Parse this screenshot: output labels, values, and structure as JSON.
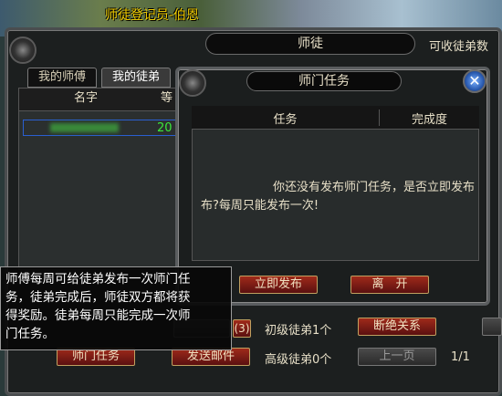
{
  "npc_title": "师徒登记员-伯恩",
  "main": {
    "title": "师徒",
    "cap_label": "可收徒弟数",
    "tabs": [
      {
        "label": "我的师傅"
      },
      {
        "label": "我的徒弟"
      }
    ],
    "list_header_name": "名字",
    "list_header_level": "等",
    "selected_row_level": "20"
  },
  "task_dialog": {
    "title": "师门任务",
    "col_task": "任务",
    "col_progress": "完成度",
    "message_line1": "你还没有发布师门任务，是否立即发布",
    "message_line2": "布?每周只能发布一次!",
    "publish_label": "立即发布",
    "leave_label": "离　开"
  },
  "tooltip": {
    "lines": [
      "师傅每周可给徒弟发布一次师门任",
      "务，徒弟完成后，师徒双方都将获",
      "得奖励。徒弟每周只能完成一次师",
      "门任务。"
    ]
  },
  "bottom": {
    "badge_count": "(3)",
    "junior_label": "初级徒弟1个",
    "break_label": "断绝关系",
    "senior_label": "高级徒弟0个",
    "prev_label": "上一页",
    "page": "1/1",
    "sect_task_label": "师门任务",
    "send_mail_label": "发送邮件"
  }
}
